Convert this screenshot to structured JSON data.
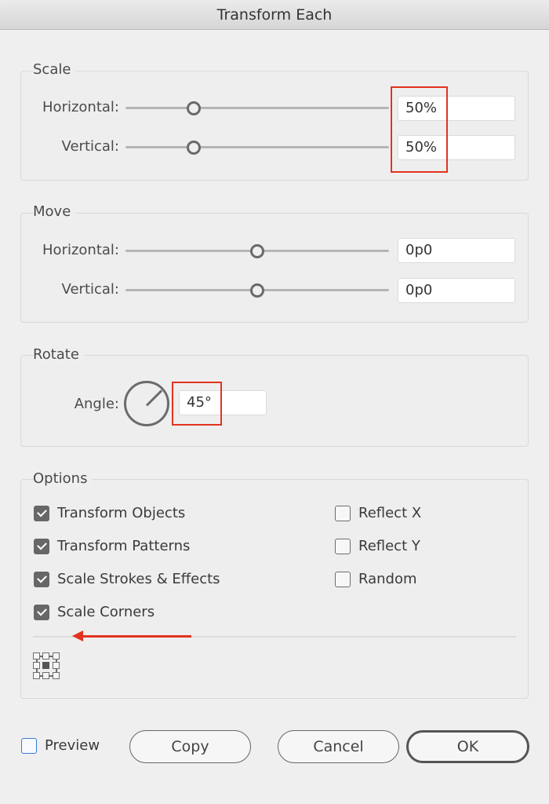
{
  "window": {
    "title": "Transform Each"
  },
  "scale": {
    "title": "Scale",
    "horizontal": {
      "label": "Horizontal:",
      "value": "50%",
      "slider_fraction": 0.26
    },
    "vertical": {
      "label": "Vertical:",
      "value": "50%",
      "slider_fraction": 0.26
    }
  },
  "move": {
    "title": "Move",
    "horizontal": {
      "label": "Horizontal:",
      "value": "0p0",
      "slider_fraction": 0.5
    },
    "vertical": {
      "label": "Vertical:",
      "value": "0p0",
      "slider_fraction": 0.5
    }
  },
  "rotate": {
    "title": "Rotate",
    "angle_label": "Angle:",
    "angle_value": "45°",
    "angle_degrees": 45
  },
  "options": {
    "title": "Options",
    "left": [
      {
        "label": "Transform Objects",
        "checked": true
      },
      {
        "label": "Transform Patterns",
        "checked": true
      },
      {
        "label": "Scale Strokes & Effects",
        "checked": true
      },
      {
        "label": "Scale Corners",
        "checked": true
      }
    ],
    "right": [
      {
        "label": "Reflect X",
        "checked": false
      },
      {
        "label": "Reflect Y",
        "checked": false
      },
      {
        "label": "Random",
        "checked": false
      }
    ],
    "reference_point": {
      "icon": "reference-point-grid-icon",
      "selected": "center"
    }
  },
  "annotations": {
    "highlight_color": "#e2331e",
    "arrow_icon": "arrow-left-icon"
  },
  "footer": {
    "preview_label": "Preview",
    "preview_checked": false,
    "copy_label": "Copy",
    "cancel_label": "Cancel",
    "ok_label": "OK"
  }
}
